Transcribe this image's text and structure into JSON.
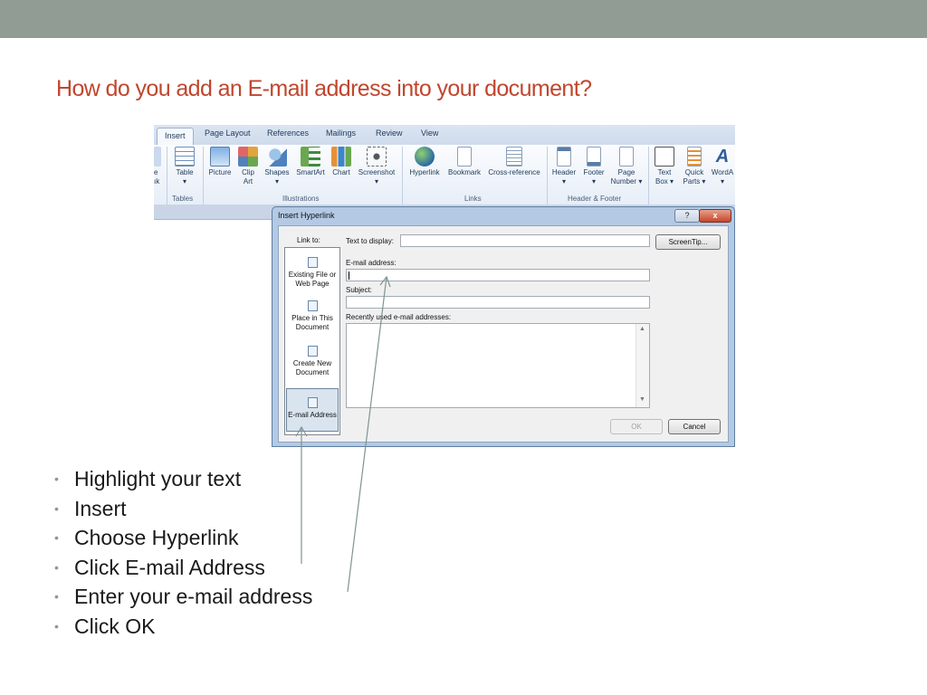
{
  "slide": {
    "title": "How do you add an E-mail address into your document?",
    "bullets": [
      "Highlight your text",
      "Insert",
      "Choose Hyperlink",
      "Click E-mail Address",
      "Enter your e-mail address",
      "Click OK"
    ]
  },
  "ribbon": {
    "tabs": [
      "Insert",
      "Page Layout",
      "References",
      "Mailings",
      "Review",
      "View"
    ],
    "partial_left": [
      "e",
      "ık"
    ],
    "buttons": {
      "table": "Table",
      "picture": "Picture",
      "clip_art_1": "Clip",
      "clip_art_2": "Art",
      "shapes": "Shapes",
      "smartart": "SmartArt",
      "chart": "Chart",
      "screenshot": "Screenshot",
      "hyperlink": "Hyperlink",
      "bookmark": "Bookmark",
      "cross_reference": "Cross-reference",
      "header": "Header",
      "footer": "Footer",
      "page_number_1": "Page",
      "page_number_2": "Number ▾",
      "text_box_1": "Text",
      "text_box_2": "Box ▾",
      "quick_parts_1": "Quick",
      "quick_parts_2": "Parts ▾",
      "wordart": "WordA"
    },
    "groups": [
      "Tables",
      "Illustrations",
      "Links",
      "Header & Footer"
    ]
  },
  "dialog": {
    "title": "Insert Hyperlink",
    "help": "?",
    "close": "x",
    "link_to_label": "Link to:",
    "link_options": [
      {
        "line1": "Existing File or",
        "line2": "Web Page"
      },
      {
        "line1": "Place in This",
        "line2": "Document"
      },
      {
        "line1": "Create New",
        "line2": "Document"
      },
      {
        "line1": "E-mail Address",
        "line2": ""
      }
    ],
    "text_to_display_label": "Text to display:",
    "text_to_display_value": "",
    "screentip_button": "ScreenTip...",
    "email_label": "E-mail address:",
    "email_value": "",
    "subject_label": "Subject:",
    "subject_value": "",
    "recent_label": "Recently used e-mail addresses:",
    "ok_button": "OK",
    "cancel_button": "Cancel"
  },
  "colors": {
    "title": "#c0462e",
    "topbar": "#919c95",
    "arrow": "#7e9590"
  }
}
